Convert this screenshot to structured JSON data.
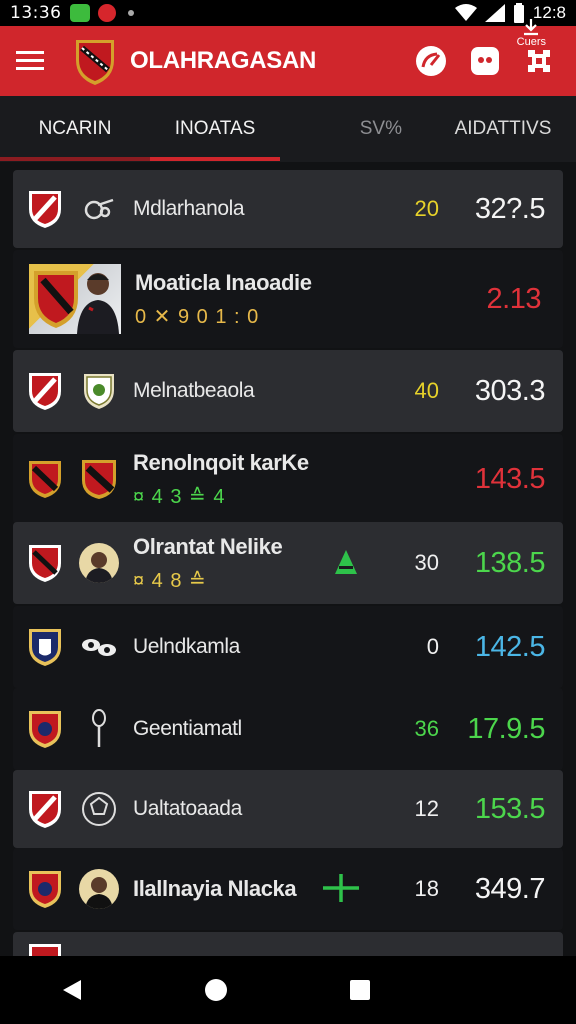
{
  "status_bar": {
    "time": "13:36",
    "time_right": "12:8"
  },
  "app": {
    "title": "OLAHRAGASAN"
  },
  "tabs": [
    {
      "label": "NCARIN"
    },
    {
      "label": "INOATAS"
    },
    {
      "label": "SV%"
    },
    {
      "label": "AIDATTIVS"
    }
  ],
  "rows": [
    {
      "name": "Mdlarhanola",
      "sub": "",
      "num": "20",
      "num_color": "#e7d22a",
      "value": "32?.5",
      "value_color": "#f4f4f4"
    },
    {
      "name": "Moaticla Inaoadie",
      "sub": "0 ✕ 9 0 1 : 0",
      "num": "",
      "num_color": "",
      "value": "2.13",
      "value_color": "#e0323a"
    },
    {
      "name": "Melnatbeaola",
      "sub": "",
      "num": "40",
      "num_color": "#e7d22a",
      "value": "303.3",
      "value_color": "#f4f4f4"
    },
    {
      "name": "Renolnqoit karKe",
      "sub": "¤ 4 3 ≙ 4",
      "num": "",
      "num_color": "",
      "value": "143.5",
      "value_color": "#e0323a"
    },
    {
      "name": "Olrantat Nelike",
      "sub": "¤ 4 8 ≙",
      "num": "30",
      "num_color": "#f0f0f0",
      "value": "138.5",
      "value_color": "#4cd64c"
    },
    {
      "name": "Uelndkamla",
      "sub": "",
      "num": "0",
      "num_color": "#f0f0f0",
      "value": "142.5",
      "value_color": "#4bb6e6"
    },
    {
      "name": "Geentiamatl",
      "sub": "",
      "num": "36",
      "num_color": "#4cd64c",
      "value": "17.9.5",
      "value_color": "#4cd64c"
    },
    {
      "name": "Ualtatoaada",
      "sub": "",
      "num": "12",
      "num_color": "#f0f0f0",
      "value": "153.5",
      "value_color": "#4cd64c"
    },
    {
      "name": "Ilallnayia Nlacka",
      "sub": "",
      "num": "18",
      "num_color": "#f0f0f0",
      "value": "349.7",
      "value_color": "#f4f4f4"
    }
  ],
  "nav": {
    "right_label": "Cuers"
  },
  "colors": {
    "brand": "#d0262c",
    "background": "#111214"
  }
}
